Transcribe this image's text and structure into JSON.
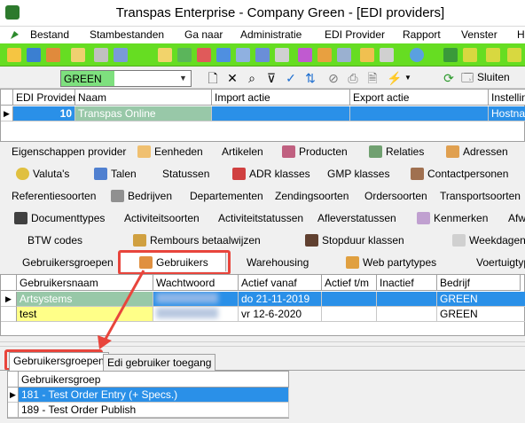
{
  "window": {
    "title": "Transpas Enterprise - Company Green - [EDI providers]"
  },
  "menu": [
    "Bestand",
    "Stambestanden",
    "Ga naar",
    "Administratie",
    "EDI Provider",
    "Rapport",
    "Venster",
    "H"
  ],
  "toolbar": {
    "company_value": "GREEN",
    "close_label": "Sluiten"
  },
  "providers_grid": {
    "columns": [
      "EDI Provider",
      "Naam",
      "Import actie",
      "Export actie",
      "Instelling"
    ],
    "rows": [
      {
        "id": "10",
        "name": "Transpas Online",
        "import": "",
        "export": "",
        "setting": "Hostnam"
      }
    ]
  },
  "tabs": {
    "row1": [
      "Eigenschappen provider",
      "Eenheden",
      "Artikelen",
      "Producten",
      "Relaties",
      "Adressen"
    ],
    "row2": [
      "Valuta's",
      "Talen",
      "Statussen",
      "ADR klasses",
      "GMP klasses",
      "Contactpersonen"
    ],
    "row3": [
      "Referentiesoorten",
      "Bedrijven",
      "Departementen",
      "Zendingsoorten",
      "Ordersoorten",
      "Transportsoorten"
    ],
    "row4": [
      "Documenttypes",
      "Activiteitsoorten",
      "Activiteitstatussen",
      "Afleverstatussen",
      "Kenmerken",
      "Afw"
    ],
    "row5": [
      "BTW codes",
      "Rembours betaalwijzen",
      "Stopduur klassen",
      "Weekdagen"
    ],
    "row6": [
      "Gebruikersgroepen",
      "Gebruikers",
      "Warehousing",
      "Web partytypes",
      "Voertuigtype"
    ]
  },
  "users_grid": {
    "columns": [
      "Gebruikersnaam",
      "Wachtwoord",
      "Actief vanaf",
      "Actief t/m",
      "Inactief",
      "Bedrijf"
    ],
    "rows": [
      {
        "name": "Artsystems",
        "active_from": "do 21-11-2019",
        "active_to": "",
        "inactive": "",
        "company": "GREEN"
      },
      {
        "name": "test",
        "active_from": "vr 12-6-2020",
        "active_to": "",
        "inactive": "",
        "company": "GREEN"
      }
    ]
  },
  "bottom_tabs": [
    "Gebruikersgroepen",
    "Edi gebruiker toegang"
  ],
  "groups_grid": {
    "column": "Gebruikersgroep",
    "rows": [
      "181 - Test Order Entry (+ Specs.)",
      "189 - Test Order Publish"
    ]
  }
}
